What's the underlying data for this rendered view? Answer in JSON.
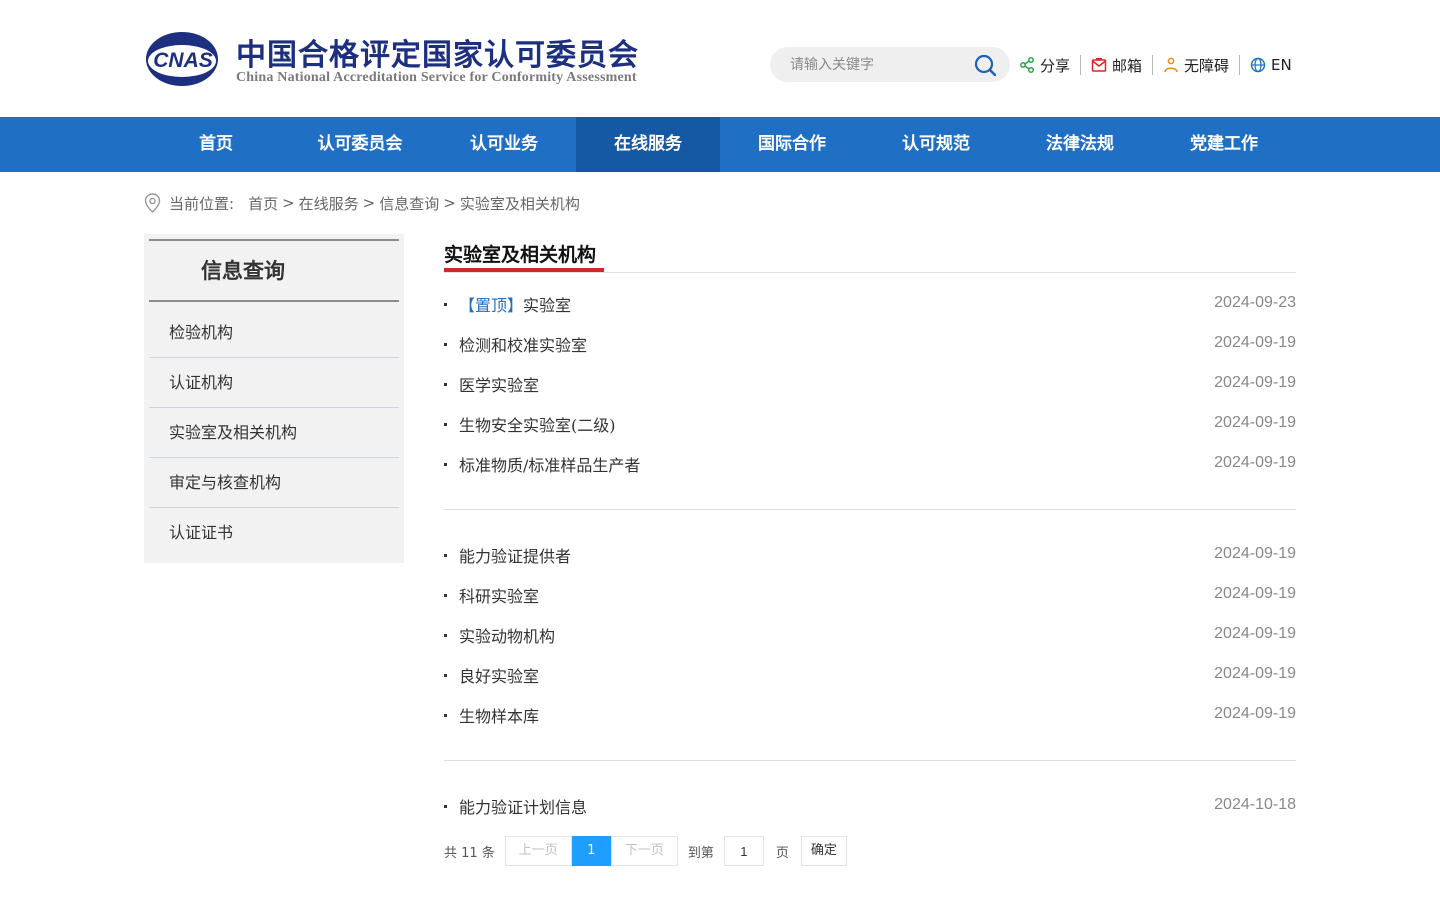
{
  "header": {
    "logo_mark": "CNAS",
    "logo_cn": "中国合格评定国家认可委员会",
    "logo_en": "China National Accreditation Service for Conformity Assessment",
    "search_placeholder": "请输入关键字",
    "tools": [
      {
        "label": "分享",
        "icon": "share-icon",
        "color": "#2aa34a"
      },
      {
        "label": "邮箱",
        "icon": "mail-icon",
        "color": "#d7262b"
      },
      {
        "label": "无障碍",
        "icon": "accessibility-icon",
        "color": "#f08a1c"
      },
      {
        "label": "EN",
        "icon": "globe-icon",
        "color": "#1f6fc5"
      }
    ]
  },
  "nav": {
    "items": [
      "首页",
      "认可委员会",
      "认可业务",
      "在线服务",
      "国际合作",
      "认可规范",
      "法律法规",
      "党建工作"
    ],
    "active": "在线服务",
    "color": "#1f6fc5"
  },
  "breadcrumb": {
    "prefix": "当前位置:",
    "items": [
      "首页",
      "在线服务",
      "信息查询",
      "实验室及相关机构"
    ],
    "separator": ">"
  },
  "sidebar": {
    "title": "信息查询",
    "items": [
      "检验机构",
      "认证机构",
      "实验室及相关机构",
      "审定与核查机构",
      "认证证书"
    ]
  },
  "main": {
    "title": "实验室及相关机构",
    "pin_label": "【置顶】",
    "groups": [
      [
        {
          "title": "实验室",
          "date": "2024-09-23",
          "pinned": true
        },
        {
          "title": "检测和校准实验室",
          "date": "2024-09-19"
        },
        {
          "title": "医学实验室",
          "date": "2024-09-19"
        },
        {
          "title": "生物安全实验室(二级)",
          "date": "2024-09-19"
        },
        {
          "title": "标准物质/标准样品生产者",
          "date": "2024-09-19"
        }
      ],
      [
        {
          "title": "能力验证提供者",
          "date": "2024-09-19"
        },
        {
          "title": "科研实验室",
          "date": "2024-09-19"
        },
        {
          "title": "实验动物机构",
          "date": "2024-09-19"
        },
        {
          "title": "良好实验室",
          "date": "2024-09-19"
        },
        {
          "title": "生物样本库",
          "date": "2024-09-19"
        }
      ],
      [
        {
          "title": "能力验证计划信息",
          "date": "2024-10-18"
        }
      ]
    ]
  },
  "pager": {
    "total_text": "共 11 条",
    "prev": "上一页",
    "current": "1",
    "next": "下一页",
    "goto_prefix": "到第",
    "goto_value": "1",
    "goto_suffix": "页",
    "confirm": "确定"
  }
}
